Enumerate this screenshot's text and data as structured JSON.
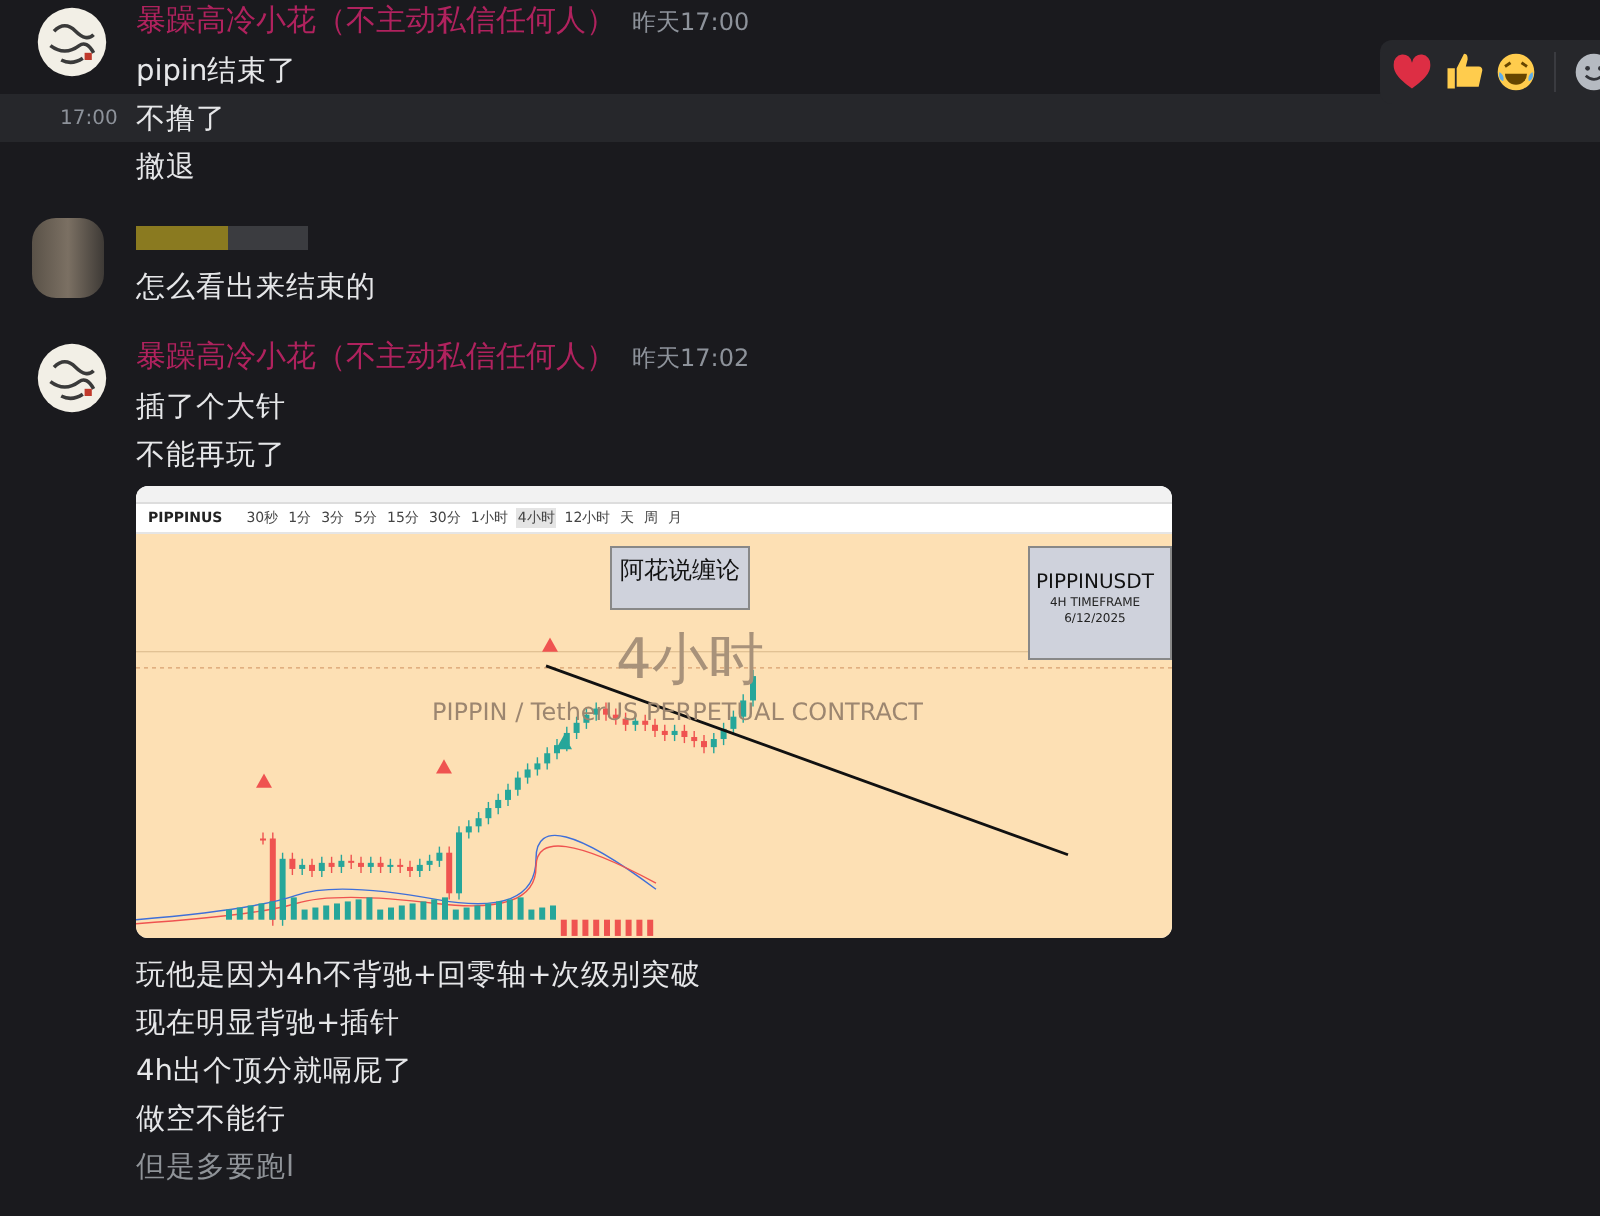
{
  "groups": [
    {
      "author_blurred": false,
      "author": "暴躁高冷小花（不主动私信任何人）",
      "time": "昨天17:00",
      "items": [
        {
          "kind": "text",
          "text": "pipin结束了",
          "highlighted": false,
          "dimmed": false
        },
        {
          "kind": "text",
          "text": "不撸了",
          "highlighted": true,
          "hover_time": "17:00",
          "dimmed": false
        },
        {
          "kind": "text",
          "text": "撤退",
          "highlighted": false,
          "dimmed": false
        }
      ]
    },
    {
      "author_blurred": true,
      "items": [
        {
          "kind": "text",
          "text": "怎么看出来结束的",
          "highlighted": false,
          "dimmed": false
        }
      ]
    },
    {
      "author_blurred": false,
      "author": "暴躁高冷小花（不主动私信任何人）",
      "time": "昨天17:02",
      "items": [
        {
          "kind": "text",
          "text": "插了个大针",
          "highlighted": false,
          "dimmed": false
        },
        {
          "kind": "text",
          "text": "不能再玩了",
          "highlighted": false,
          "dimmed": false
        },
        {
          "kind": "image",
          "symbol": "PIPPINUS",
          "timeframes": [
            {
              "label": "30秒",
              "selected": false
            },
            {
              "label": "1分",
              "selected": false
            },
            {
              "label": "3分",
              "selected": false
            },
            {
              "label": "5分",
              "selected": false
            },
            {
              "label": "15分",
              "selected": false
            },
            {
              "label": "30分",
              "selected": false
            },
            {
              "label": "1小时",
              "selected": false
            },
            {
              "label": "4小时",
              "selected": true
            },
            {
              "label": "12小时",
              "selected": false
            },
            {
              "label": "天",
              "selected": false
            },
            {
              "label": "周",
              "selected": false
            },
            {
              "label": "月",
              "selected": false
            }
          ],
          "banner": "阿花说缠论",
          "card_title": "PIPPINUSDT",
          "card_subtitle": "4H TIMEFRAME",
          "card_date": "6/12/2025",
          "watermark_big": "4小时",
          "watermark_small": "PIPPIN / TetherUS PERPETUAL CONTRACT"
        },
        {
          "kind": "text",
          "text": "玩他是因为4h不背驰+回零轴+次级别突破",
          "highlighted": false,
          "dimmed": false
        },
        {
          "kind": "text",
          "text": "现在明显背驰+插针",
          "highlighted": false,
          "dimmed": false
        },
        {
          "kind": "text",
          "text": "4h出个顶分就嗝屁了",
          "highlighted": false,
          "dimmed": false
        },
        {
          "kind": "text",
          "text": "做空不能行",
          "highlighted": false,
          "dimmed": false
        },
        {
          "kind": "text",
          "text": "但是多要跑l",
          "highlighted": false,
          "dimmed": true
        }
      ]
    }
  ]
}
